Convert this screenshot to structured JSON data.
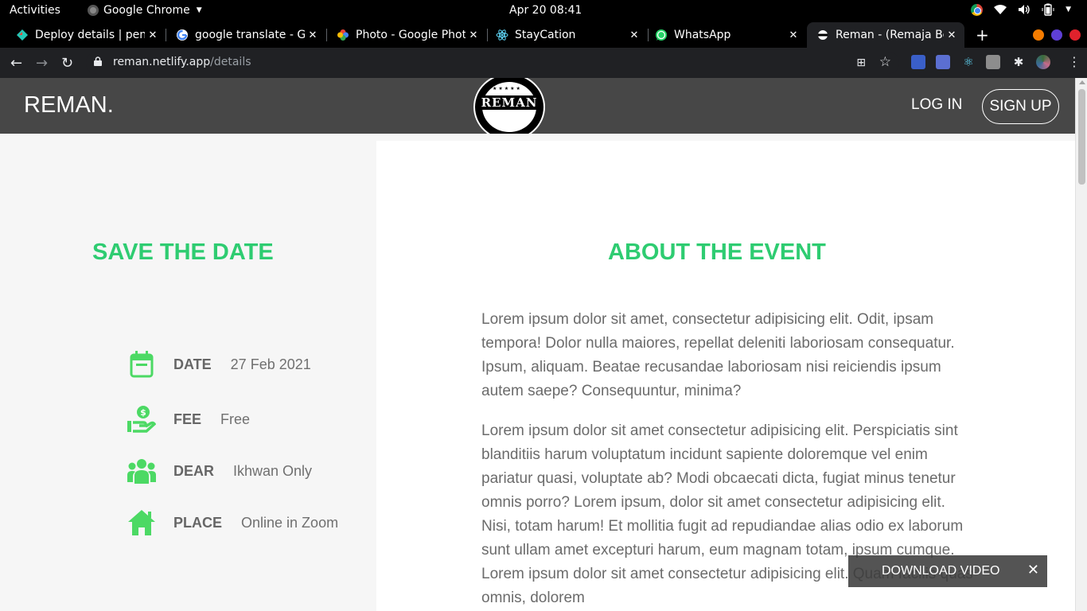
{
  "system": {
    "activities": "Activities",
    "app_name": "Google Chrome",
    "datetime": "Apr 20  08:41"
  },
  "tabs": [
    {
      "title": "Deploy details | pen",
      "favicon": "netlify-icon",
      "active": false
    },
    {
      "title": "google translate - G",
      "favicon": "google-icon",
      "active": false
    },
    {
      "title": "Photo - Google Phot",
      "favicon": "google-photos-icon",
      "active": false
    },
    {
      "title": "StayCation",
      "favicon": "react-icon",
      "active": false
    },
    {
      "title": "WhatsApp",
      "favicon": "whatsapp-icon",
      "active": false
    },
    {
      "title": "Reman - (Remaja Be",
      "favicon": "reman-icon",
      "active": true
    }
  ],
  "omnibox": {
    "host": "reman.netlify.app",
    "path": "/details"
  },
  "site": {
    "brand": "REMAN.",
    "logo_text": "REMAN",
    "login": "LOG IN",
    "signup": "SIGN UP"
  },
  "save_the_date": {
    "title": "SAVE THE DATE",
    "items": [
      {
        "label": "DATE",
        "value": "27 Feb 2021",
        "icon": "calendar-icon"
      },
      {
        "label": "FEE",
        "value": "Free",
        "icon": "money-hand-icon"
      },
      {
        "label": "DEAR",
        "value": "Ikhwan Only",
        "icon": "users-icon"
      },
      {
        "label": "PLACE",
        "value": "Online in Zoom",
        "icon": "home-icon"
      }
    ]
  },
  "about": {
    "title": "ABOUT THE EVENT",
    "paragraph1": "Lorem ipsum dolor sit amet, consectetur adipisicing elit. Odit, ipsam tempora! Dolor nulla maiores, repellat deleniti laboriosam consequatur. Ipsum, aliquam. Beatae recusandae laboriosam nisi reiciendis ipsum autem saepe? Consequuntur, minima?",
    "paragraph2": "Lorem ipsum dolor sit amet consectetur adipisicing elit. Perspiciatis sint blanditiis harum voluptatum incidunt sapiente doloremque vel enim pariatur quasi, voluptate ab? Modi obcaecati dicta, fugiat minus tenetur omnis porro? Lorem ipsum, dolor sit amet consectetur adipisicing elit. Nisi, totam harum! Et mollitia fugit ad repudiandae alias odio ex laborum sunt ullam amet excepturi harum, eum magnam totam, ipsum cumque. Lorem ipsum dolor sit amet consectetur adipisicing elit. Quam facilis quas omnis, dolorem"
  },
  "download_bar": {
    "label": "DOWNLOAD VIDEO"
  },
  "colors": {
    "accent_green": "#2ecc71",
    "nav_bg": "#474747"
  }
}
